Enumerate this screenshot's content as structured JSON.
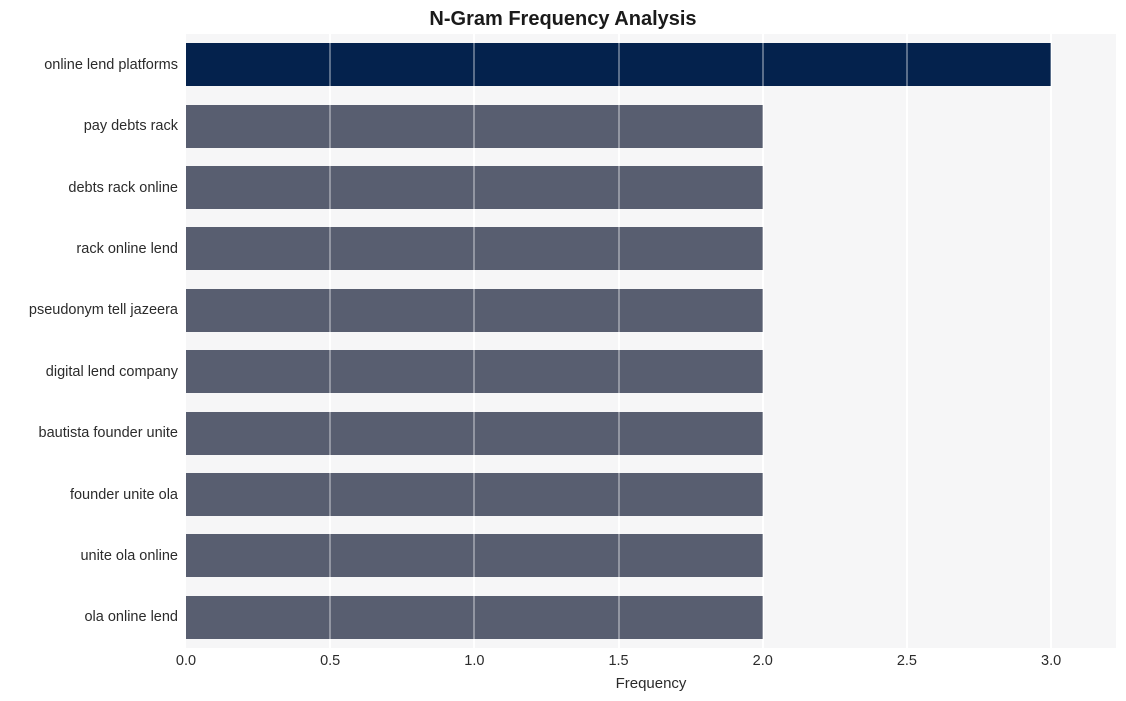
{
  "chart_data": {
    "type": "bar",
    "orientation": "horizontal",
    "title": "N-Gram Frequency Analysis",
    "xlabel": "Frequency",
    "ylabel": "",
    "categories": [
      "online lend platforms",
      "pay debts rack",
      "debts rack online",
      "rack online lend",
      "pseudonym tell jazeera",
      "digital lend company",
      "bautista founder unite",
      "founder unite ola",
      "unite ola online",
      "ola online lend"
    ],
    "values": [
      3,
      2,
      2,
      2,
      2,
      2,
      2,
      2,
      2,
      2
    ],
    "xlim": [
      0.0,
      3.225
    ],
    "xticks": [
      "0.0",
      "0.5",
      "1.0",
      "1.5",
      "2.0",
      "2.5",
      "3.0"
    ],
    "xtick_values": [
      0.0,
      0.5,
      1.0,
      1.5,
      2.0,
      2.5,
      3.0
    ],
    "grid": true,
    "grid_axis": "x",
    "legend": false,
    "bar_colors": [
      "#04224d",
      "#585e70",
      "#585e70",
      "#585e70",
      "#585e70",
      "#585e70",
      "#585e70",
      "#585e70",
      "#585e70",
      "#585e70"
    ],
    "highlight_color": "#04224d",
    "base_color": "#585e70",
    "plot_background": "#f6f6f7",
    "grid_color": "#ffffff",
    "figure_background": "#ffffff",
    "text_color": "#2b2b2b",
    "title_color": "#1a1a1a"
  }
}
